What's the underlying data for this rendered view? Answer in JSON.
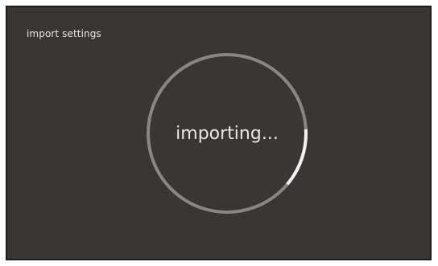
{
  "window": {
    "title": "import settings"
  },
  "progress": {
    "status_text": "importing...",
    "fraction": 0.12,
    "track_color": "#8a8683",
    "fill_color": "#f2f2f2",
    "background_color": "#3a3633"
  }
}
